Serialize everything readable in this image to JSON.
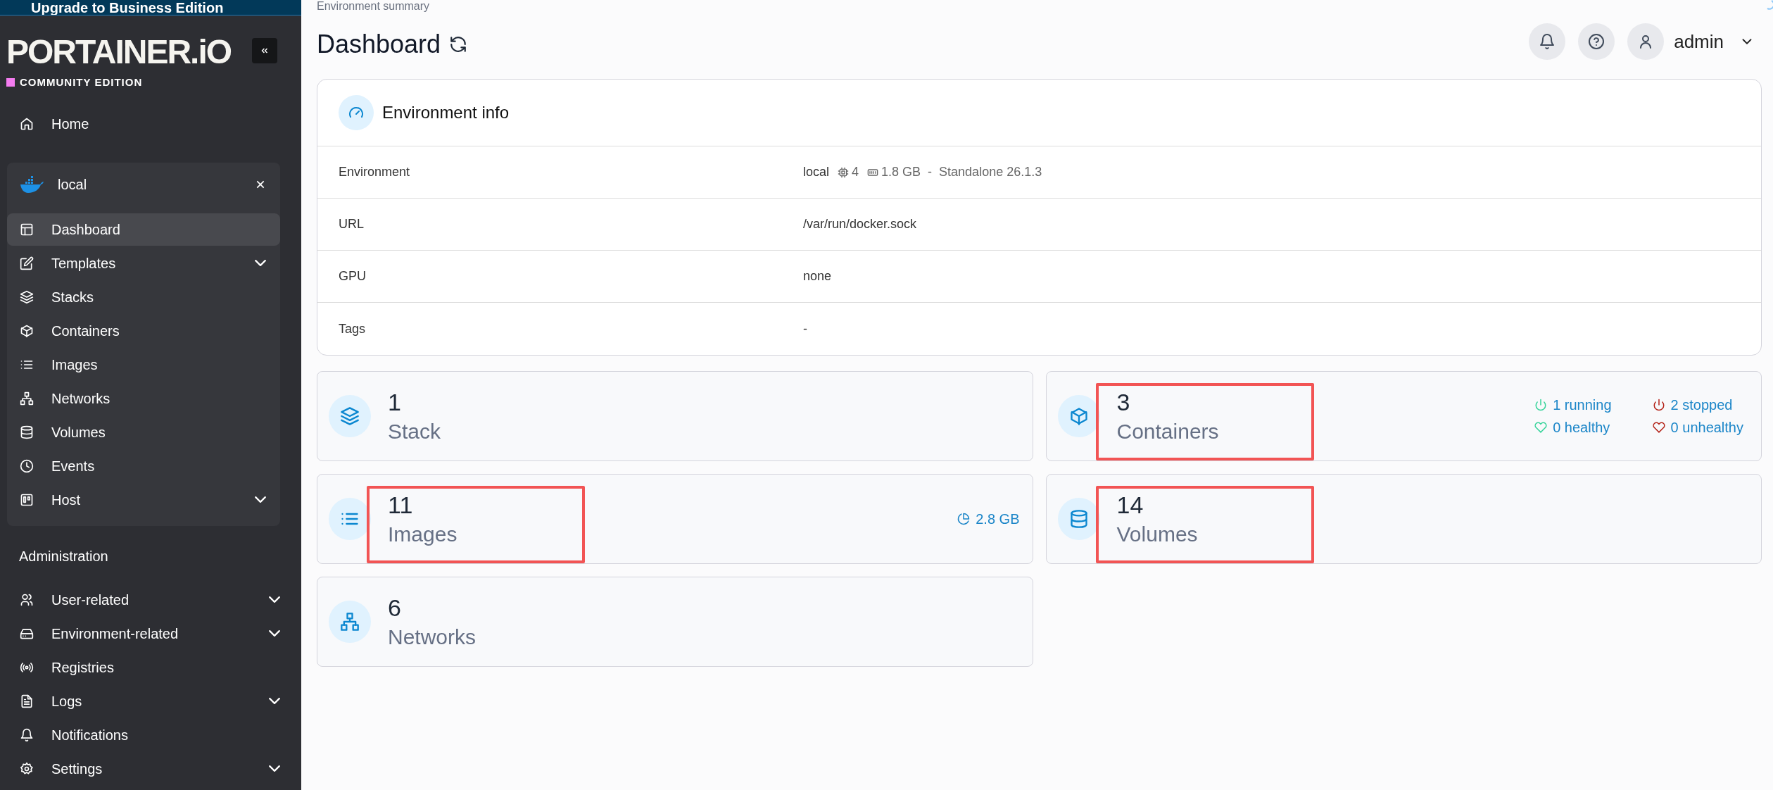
{
  "banner": {
    "text": "Upgrade to Business Edition"
  },
  "sidebar": {
    "logo": "PORTAINER.iO",
    "edition": "COMMUNITY EDITION",
    "home": {
      "label": "Home"
    },
    "environment": {
      "name": "local",
      "items": [
        {
          "label": "Dashboard",
          "expandable": false,
          "selected": true
        },
        {
          "label": "Templates",
          "expandable": true,
          "selected": false
        },
        {
          "label": "Stacks",
          "expandable": false,
          "selected": false
        },
        {
          "label": "Containers",
          "expandable": false,
          "selected": false
        },
        {
          "label": "Images",
          "expandable": false,
          "selected": false
        },
        {
          "label": "Networks",
          "expandable": false,
          "selected": false
        },
        {
          "label": "Volumes",
          "expandable": false,
          "selected": false
        },
        {
          "label": "Events",
          "expandable": false,
          "selected": false
        },
        {
          "label": "Host",
          "expandable": true,
          "selected": false
        }
      ]
    },
    "section_title": "Administration",
    "admin_items": [
      {
        "label": "User-related",
        "expandable": true,
        "selected": false
      },
      {
        "label": "Environment-related",
        "expandable": true,
        "selected": false
      },
      {
        "label": "Registries",
        "expandable": false,
        "selected": false
      },
      {
        "label": "Logs",
        "expandable": true,
        "selected": false
      },
      {
        "label": "Notifications",
        "expandable": false,
        "selected": false
      },
      {
        "label": "Settings",
        "expandable": true,
        "selected": false
      }
    ]
  },
  "breadcrumb": "Environment summary",
  "title": "Dashboard",
  "user": {
    "name": "admin"
  },
  "environment_info": {
    "title": "Environment info",
    "rows": [
      {
        "label": "Environment",
        "kind": "environment",
        "name": "local",
        "cpu": "4",
        "memory": "1.8 GB",
        "separator": "-",
        "type": "Standalone 26.1.3"
      },
      {
        "label": "URL",
        "kind": "text",
        "value": "/var/run/docker.sock"
      },
      {
        "label": "GPU",
        "kind": "text",
        "value": "none"
      },
      {
        "label": "Tags",
        "kind": "text",
        "value": "-"
      }
    ]
  },
  "tiles": [
    {
      "count": "1",
      "label": "Stack",
      "highlighted": false
    },
    {
      "count": "3",
      "label": "Containers",
      "highlighted": true,
      "stats": [
        {
          "color": "#34d399",
          "text": "1 running"
        },
        {
          "color": "#b42318",
          "text": "2 stopped"
        },
        {
          "color": "#34d399",
          "text": "0 healthy"
        },
        {
          "color": "#b42318",
          "text": "0 unhealthy"
        }
      ]
    },
    {
      "count": "11",
      "label": "Images",
      "highlighted": true,
      "size": "2.8 GB"
    },
    {
      "count": "14",
      "label": "Volumes",
      "highlighted": true
    },
    {
      "count": "6",
      "label": "Networks",
      "highlighted": false
    }
  ]
}
